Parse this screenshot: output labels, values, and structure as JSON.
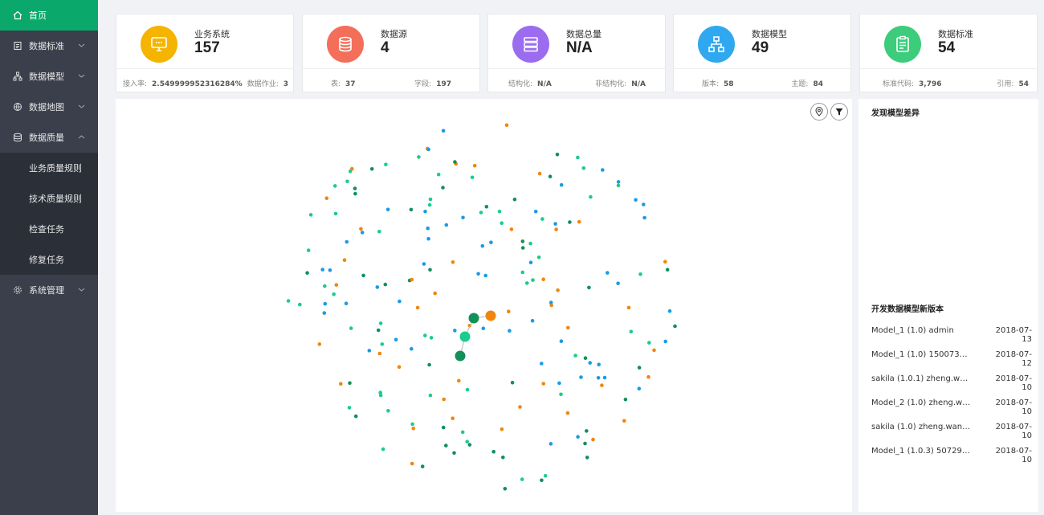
{
  "sidebar": {
    "items": [
      {
        "label": "首页",
        "icon": "home-icon"
      },
      {
        "label": "数据标准",
        "icon": "document-icon"
      },
      {
        "label": "数据模型",
        "icon": "model-icon"
      },
      {
        "label": "数据地图",
        "icon": "map-icon"
      },
      {
        "label": "数据质量",
        "icon": "quality-icon"
      },
      {
        "label": "系统管理",
        "icon": "gear-icon"
      }
    ],
    "submenu": [
      "业务质量规则",
      "技术质量规则",
      "检查任务",
      "修复任务"
    ]
  },
  "cards": [
    {
      "title": "业务系统",
      "value": "157",
      "color": "#f5b400",
      "icon": "monitor-icon",
      "left_label": "接入率:",
      "left_value": "2.549999952316284%",
      "right_label": "数据作业:",
      "right_value": "3"
    },
    {
      "title": "数据源",
      "value": "4",
      "color": "#f36f5a",
      "icon": "database-icon",
      "left_label": "表:",
      "left_value": "37",
      "right_label": "字段:",
      "right_value": "197"
    },
    {
      "title": "数据总量",
      "value": "N/A",
      "color": "#9b6cf0",
      "icon": "server-icon",
      "left_label": "结构化:",
      "left_value": "N/A",
      "right_label": "非结构化:",
      "right_value": "N/A"
    },
    {
      "title": "数据模型",
      "value": "49",
      "color": "#2fa8f0",
      "icon": "hierarchy-icon",
      "left_label": "版本:",
      "left_value": "58",
      "right_label": "主题:",
      "right_value": "84"
    },
    {
      "title": "数据标准",
      "value": "54",
      "color": "#3ccc7c",
      "icon": "clipboard-icon",
      "left_label": "标准代码:",
      "left_value": "3,796",
      "right_label": "引用:",
      "right_value": "54"
    }
  ],
  "graph": {
    "colors": {
      "blue": "#1a9be6",
      "teal": "#1ccc8c",
      "green": "#12905a",
      "orange": "#f0860e"
    }
  },
  "right_panel": {
    "section1_title": "发现模型差异",
    "section2_title": "开发数据模型新版本",
    "versions": [
      {
        "name": "Model_1 (1.0) admin",
        "date": "2018-07-13"
      },
      {
        "name": "Model_1 (1.0) 1500738487...",
        "date": "2018-07-12"
      },
      {
        "name": "sakila (1.0.1) zheng.wang@...",
        "date": "2018-07-10"
      },
      {
        "name": "Model_2 (1.0) zheng.wang...",
        "date": "2018-07-10"
      },
      {
        "name": "sakila (1.0) zheng.wang@da...",
        "date": "2018-07-10"
      },
      {
        "name": "Model_1 (1.0.3) 50729553@...",
        "date": "2018-07-10"
      }
    ]
  }
}
